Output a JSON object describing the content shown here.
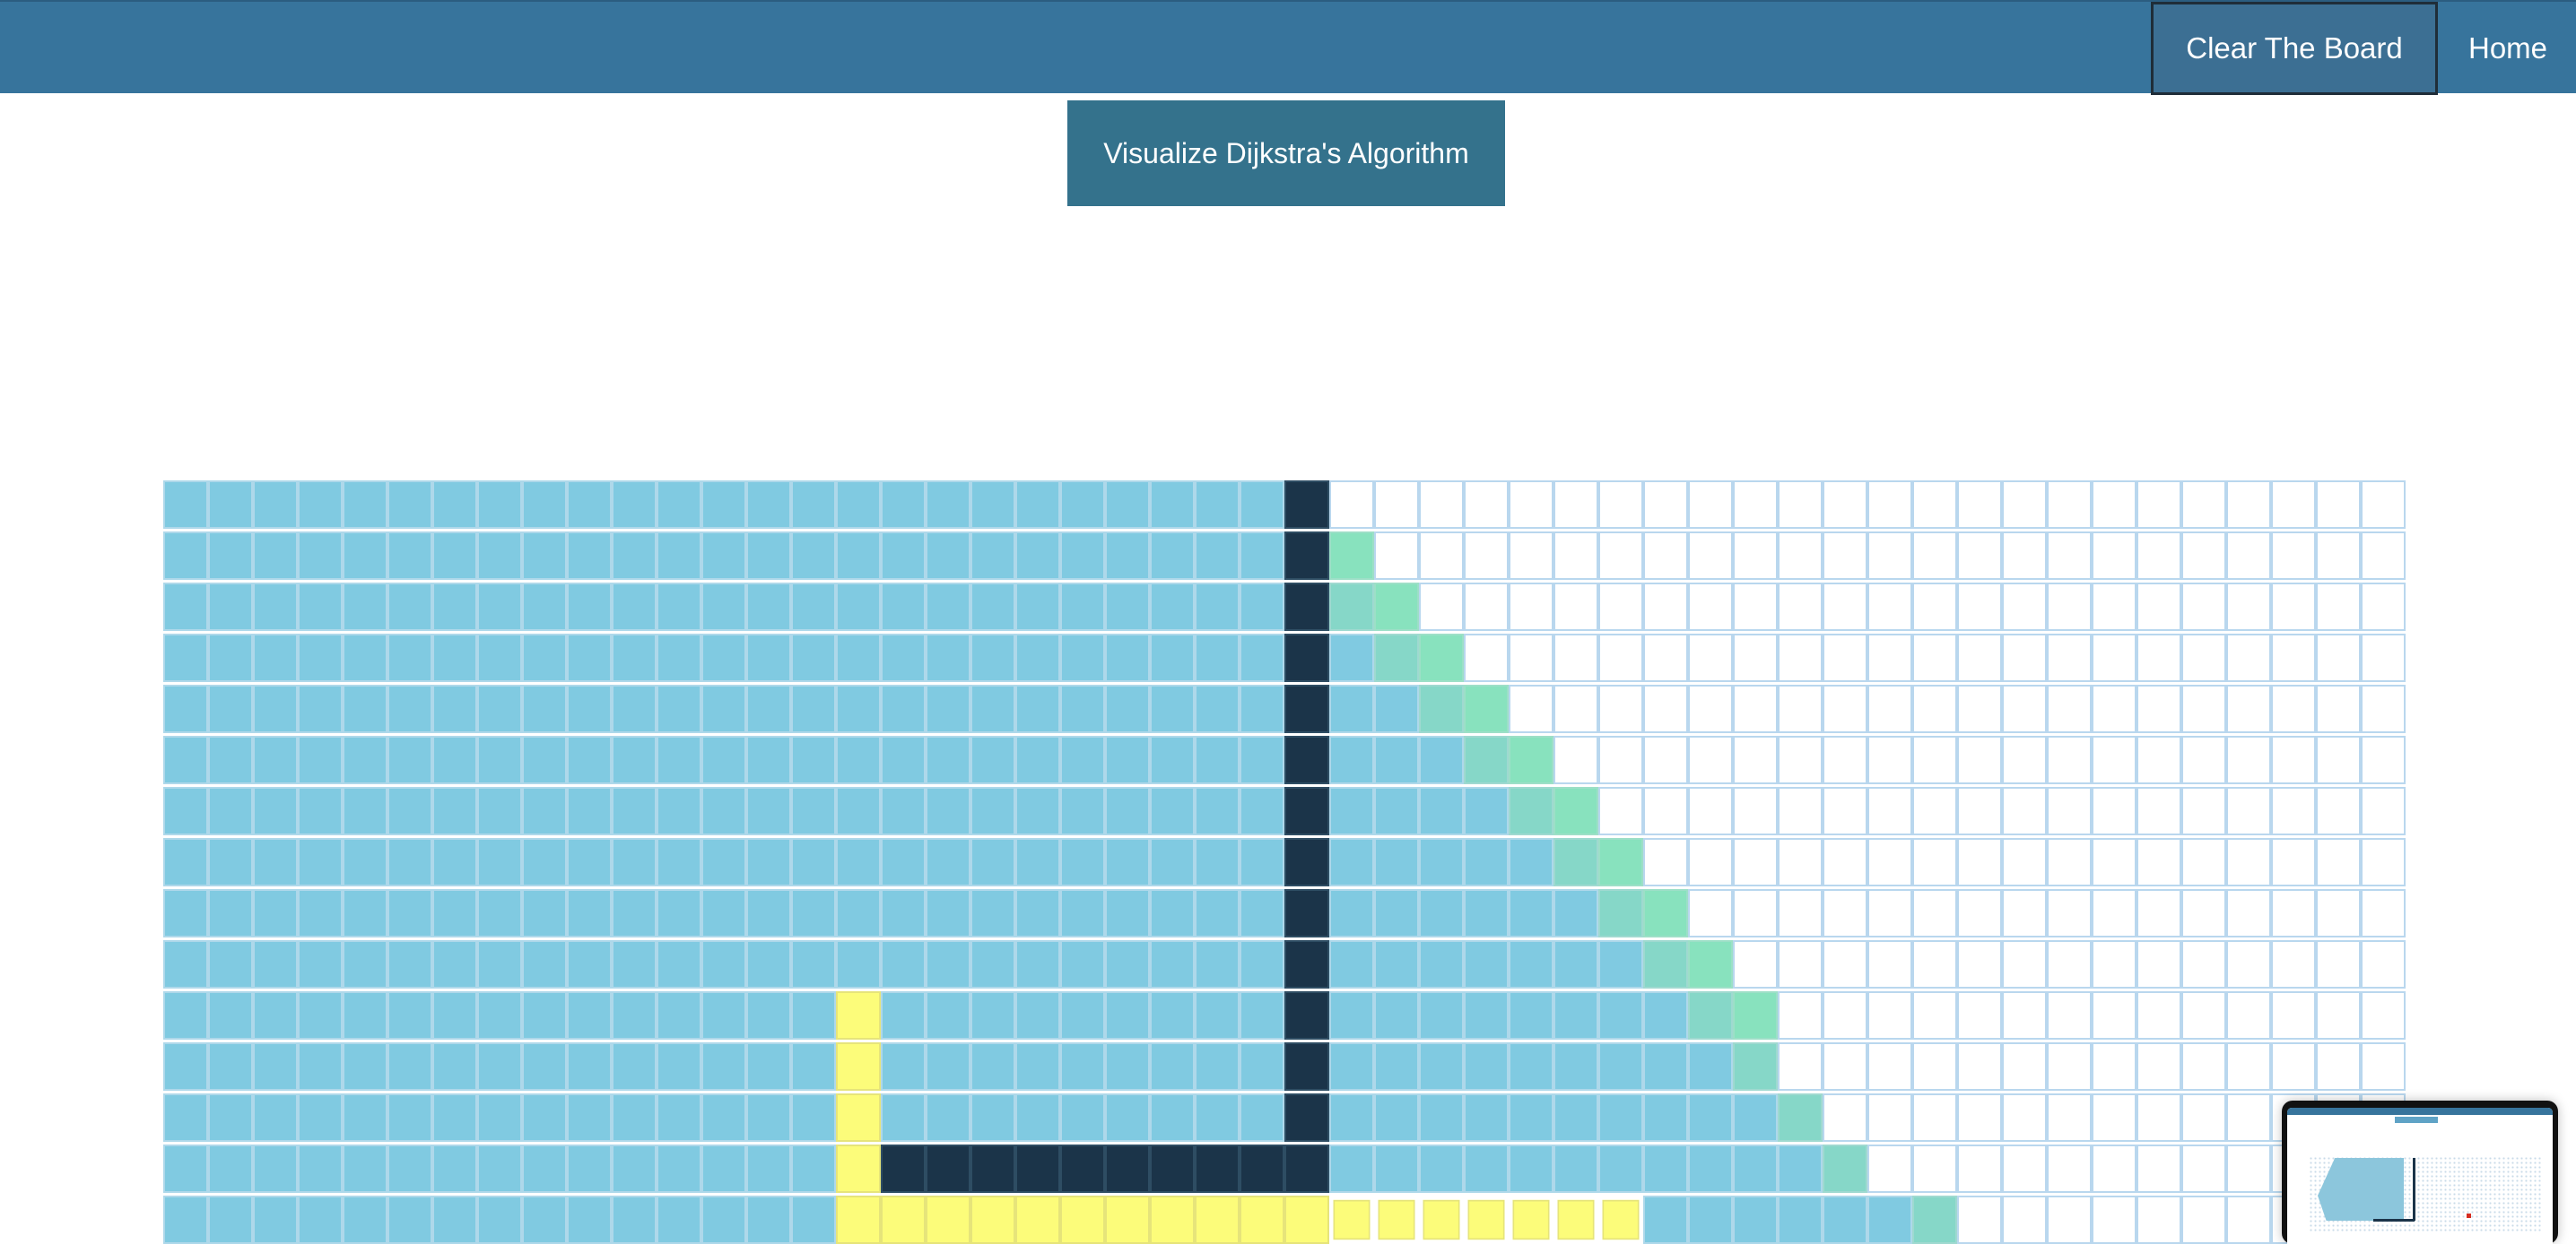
{
  "navbar": {
    "clear_label": "Clear The Board",
    "home_label": "Home"
  },
  "main": {
    "visualize_label": "Visualize Dijkstra's Algorithm"
  },
  "grid": {
    "columns": 50,
    "visible_rows": 15,
    "rows": [
      "vvvvvvvvvvvvvvvvvvvvvvvvvwuuuuuuuuuuuuuuuuuuuuuuuu",
      "vvvvvvvvvvvvvvvvvvvvvvvvvwguuuuuuuuuuuuuuuuuuuuuuu",
      "vvvvvvvvvvvvvvvvvvvvvvvvvwfguuuuuuuuuuuuuuuuuuuuuu",
      "vvvvvvvvvvvvvvvvvvvvvvvvvwvfguuuuuuuuuuuuuuuuuuuuu",
      "vvvvvvvvvvvvvvvvvvvvvvvvvwvvfguuuuuuuuuuuuuuuuuuuu",
      "vvvvvvvvvvvvvvvvvvvvvvvvvwvvvfguuuuuuuuuuuuuuuuuuu",
      "vvvvvvvvvvvvvvvvvvvvvvvvvwvvvvfguuuuuuuuuuuuuuuuuu",
      "vvvvvvvvvvvvvvvvvvvvvvvvvwvvvvvfguuuuuuuuuuuuuuuuu",
      "vvvvvvvvvvvvvvvvvvvvvvvvvwvvvvvvfguuuuuuuuuuuuuuuu",
      "vvvvvvvvvvvvvvvvvvvvvvvvvwvvvvvvvfguuuuuuuuuuuuuuu",
      "vvvvvvvvvvvvvvvpvvvvvvvvvwvvvvvvvvfguuuuuuuuuuuuuu",
      "vvvvvvvvvvvvvvvpvvvvvvvvvwvvvvvvvvvfuuuuuuuuuuuuuu",
      "vvvvvvvvvvvvvvvpvvvvvvvvvwvvvvvvvvvvfuuuuuuuuuuuuu",
      "vvvvvvvvvvvvvvvpwwwwwwwwwwvvvvvvvvvvvfuuuuuuuuuuuu",
      "vvvvvvvvvvvvvvvpppppppppppsssssssvvvvvvfuuuuuuuuuu"
    ],
    "legend": {
      "v": "visited",
      "w": "wall",
      "p": "shortest-path",
      "s": "shortest-path-animating",
      "f": "frontier",
      "g": "frontier-new",
      "u": "unvisited"
    }
  },
  "thumbnail": {
    "label": "screen-preview"
  }
}
